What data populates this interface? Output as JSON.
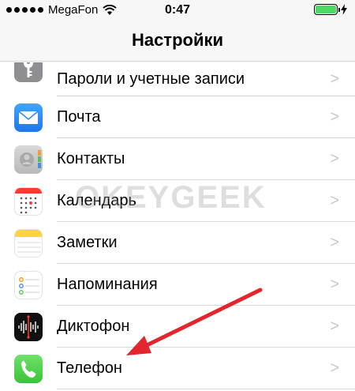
{
  "status_bar": {
    "carrier": "MegaFon",
    "time": "0:47",
    "battery_level": 1.0
  },
  "nav": {
    "title": "Настройки"
  },
  "rows": [
    {
      "label": "Пароли и учетные записи",
      "icon": "key-icon"
    },
    {
      "label": "Почта",
      "icon": "mail-icon"
    },
    {
      "label": "Контакты",
      "icon": "contacts-icon"
    },
    {
      "label": "Календарь",
      "icon": "calendar-icon"
    },
    {
      "label": "Заметки",
      "icon": "notes-icon"
    },
    {
      "label": "Напоминания",
      "icon": "reminders-icon"
    },
    {
      "label": "Диктофон",
      "icon": "voice-memos-icon"
    },
    {
      "label": "Телефон",
      "icon": "phone-icon"
    }
  ],
  "chevron": ">",
  "watermark": "OKEYGEEK",
  "colors": {
    "arrow": "#e3262d",
    "battery": "#4cd964",
    "mail": "#2a8bf2",
    "phone": "#4cd964"
  }
}
